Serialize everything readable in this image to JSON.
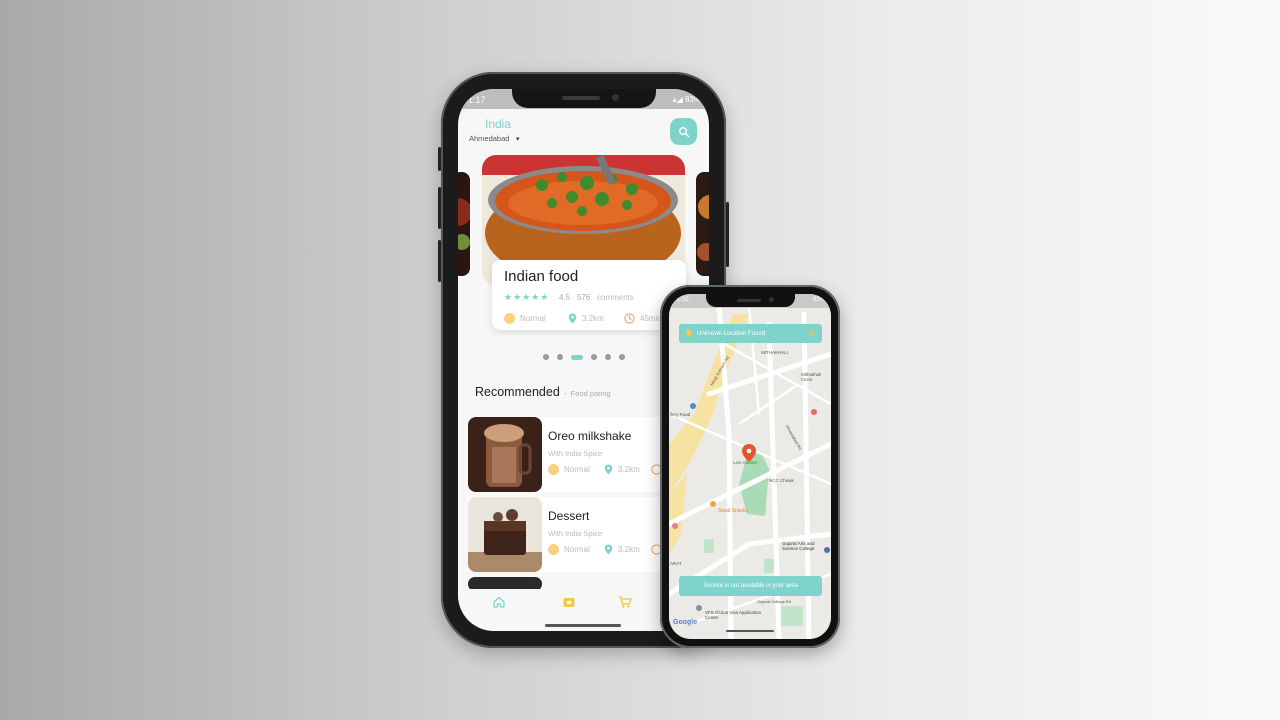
{
  "big_phone": {
    "status": {
      "time": "1:17",
      "right": "83%"
    },
    "location": {
      "country": "India",
      "city": "Ahmedabad",
      "caret": "▾"
    },
    "hero": {
      "title": "Indian food",
      "stars": "★★★★★",
      "rating": "4.5",
      "comments_count": "576",
      "comments_label": "comments",
      "spice": "Normal",
      "distance": "3.2km",
      "time": "45min"
    },
    "dots": {
      "count": 6,
      "active": 2
    },
    "recommended": {
      "title": "Recommended",
      "separator": "-",
      "subtitle": "Food paring"
    },
    "items": [
      {
        "name": "Oreo milkshake",
        "desc": "With India Spice",
        "spice": "Normal",
        "distance": "3.2km"
      },
      {
        "name": "Dessert",
        "desc": "With India Spice",
        "spice": "Normal",
        "distance": "3.2km"
      }
    ],
    "nav": [
      "home-icon",
      "wallet-icon",
      "cart-icon"
    ]
  },
  "small_phone": {
    "status": {
      "time": "1:32",
      "right": "83%"
    },
    "location_banner": "Unknown Location Found",
    "service_banner": "Service is not available in your area",
    "map_labels": {
      "mithakhali": "MITHAKHALI",
      "mithakhali_circle": "Mithakhali Circle",
      "law_garden": "Law Garden",
      "nc_chowk": "NCC Chowk",
      "swati_snacks": "Swati Snacks",
      "gujarat_college": "Gujarat Arts and Science College",
      "vfs": "VFS Global Visa Application Center",
      "gujarat_college_rd": "Gujarat College Rd",
      "road_1": "Netaji Subhash Rd",
      "road_2": "Ahmedabad Rd",
      "ery_road": "llery Road",
      "arat": "ARAT"
    },
    "google": "Google"
  },
  "colors": {
    "accent": "#7ed3cb",
    "spice": "#f8d27e",
    "pin": "#e4572e"
  }
}
